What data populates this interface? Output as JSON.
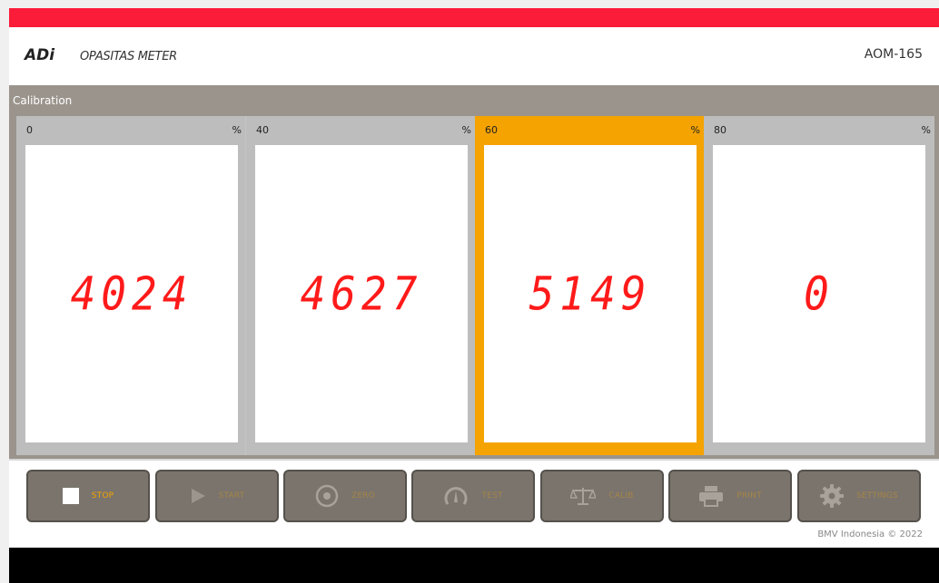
{
  "header": {
    "logo": "ADi",
    "subtitle": "OPASITAS METER",
    "model": "AOM-165"
  },
  "panel": {
    "title": "Calibration",
    "cards": [
      {
        "label": "0",
        "unit": "%",
        "value": "4024",
        "active": false
      },
      {
        "label": "40",
        "unit": "%",
        "value": "4627",
        "active": false
      },
      {
        "label": "60",
        "unit": "%",
        "value": "5149",
        "active": true
      },
      {
        "label": "80",
        "unit": "%",
        "value": "0",
        "active": false
      }
    ]
  },
  "toolbar": {
    "buttons": [
      {
        "label": "STOP",
        "icon": "stop-icon",
        "enabled": true
      },
      {
        "label": "START",
        "icon": "play-icon",
        "enabled": false
      },
      {
        "label": "ZERO",
        "icon": "target-icon",
        "enabled": false
      },
      {
        "label": "TEST",
        "icon": "gauge-icon",
        "enabled": false
      },
      {
        "label": "CALIB",
        "icon": "scale-icon",
        "enabled": false
      },
      {
        "label": "PRINT",
        "icon": "printer-icon",
        "enabled": false
      },
      {
        "label": "SETTINGS",
        "icon": "gear-icon",
        "enabled": false
      }
    ],
    "footer_note": "BMV Indonesia © 2022"
  },
  "colors": {
    "top_bar": "#fb1c3a",
    "active_card": "#f5a300",
    "display_digits": "#ff1a1a",
    "button_bg": "#7a746d",
    "button_label": "#f5a300",
    "panel_bg": "#9a948c"
  }
}
